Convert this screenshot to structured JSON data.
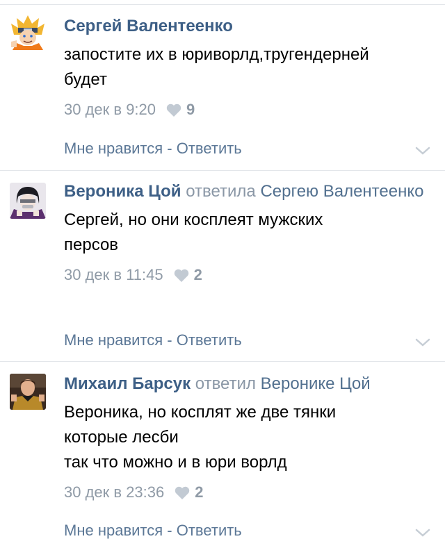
{
  "comments": [
    {
      "author": "Сергей Валентеенко",
      "reply_word": "",
      "reply_to": "",
      "text": "запостите их в юриворлд,тругендерней\nбудет",
      "time": "30 дек в 9:20",
      "likes": "9"
    },
    {
      "author": "Вероника Цой",
      "reply_word": "ответила",
      "reply_to": "Сергею Валентеенко",
      "text": "Сергей, но они косплеят мужских\nперсов",
      "time": "30 дек в 11:45",
      "likes": "2"
    },
    {
      "author": "Михаил Барсук",
      "reply_word": "ответил",
      "reply_to": "Веронике Цой",
      "text": "Вероника, но косплят же две тянки\nкоторые лесби\nтак что можно и в юри ворлд",
      "time": "30 дек в 23:36",
      "likes": "2"
    }
  ],
  "actions": {
    "like": "Мне нравится",
    "separator": " - ",
    "reply": "Ответить"
  },
  "colors": {
    "author": "#3d5f86",
    "link": "#5b7796",
    "meta": "#8f9aa6",
    "separator": "#e3e6ea"
  },
  "icons": {
    "like": "heart-icon",
    "expand": "chevron-down-icon"
  }
}
